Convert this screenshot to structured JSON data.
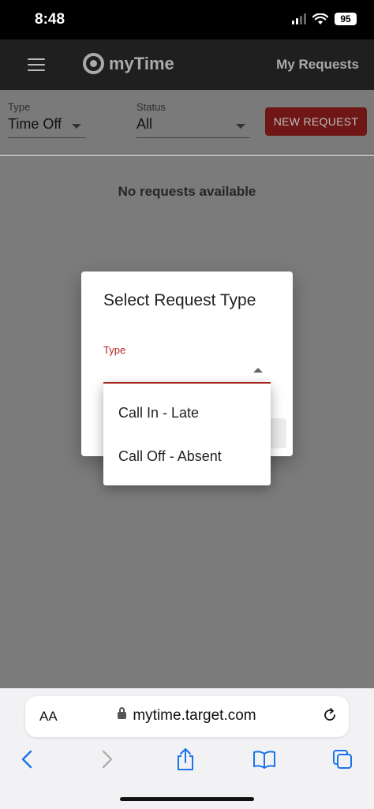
{
  "status_bar": {
    "time": "8:48",
    "battery": "95"
  },
  "header": {
    "app_name": "myTime",
    "page_title": "My Requests"
  },
  "filters": {
    "type": {
      "label": "Type",
      "value": "Time Off"
    },
    "status": {
      "label": "Status",
      "value": "All"
    },
    "new_request_label": "NEW REQUEST"
  },
  "content": {
    "empty_message": "No requests available"
  },
  "dialog": {
    "title": "Select Request Type",
    "type_label": "Type",
    "type_value": "",
    "options": [
      "Call In - Late",
      "Call Off - Absent"
    ]
  },
  "browser": {
    "text_size_label": "AA",
    "url": "mytime.target.com"
  },
  "colors": {
    "accent_red": "#b3261e",
    "header_bg": "#1f1f1f",
    "dim_overlay": "#7b7b7b"
  }
}
